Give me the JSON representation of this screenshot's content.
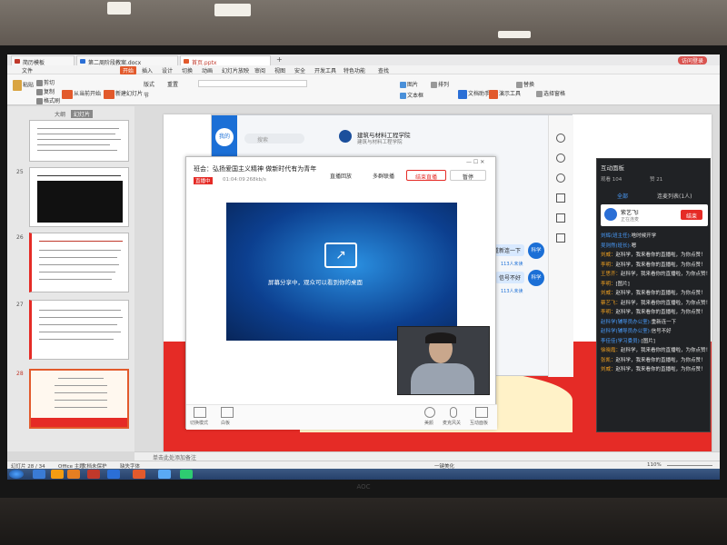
{
  "wps": {
    "tabs": [
      "简历模板",
      "第二周阶段教案.docx",
      "首页.pptx"
    ],
    "menu": [
      "文件",
      "开始",
      "插入",
      "设计",
      "切换",
      "动画",
      "幻灯片放映",
      "审阅",
      "视图",
      "安全",
      "开发工具",
      "特色功能",
      "查找"
    ],
    "menu_active": "开始",
    "login": "访问登录",
    "ribbon": {
      "paste": "粘贴",
      "cut": "剪切",
      "copy": "复制",
      "format": "格式刷",
      "from_current": "从当前开始",
      "new_slide": "新建幻灯片",
      "layout": "版式",
      "section": "节",
      "reset": "重置",
      "picture": "图片",
      "textbox": "文本框",
      "arrange": "排列",
      "doc_helper": "文档助手",
      "presentation_tools": "演示工具",
      "replace": "替换",
      "select_pane": "选择窗格"
    },
    "panel_tabs": [
      "大纲",
      "幻灯片"
    ],
    "slide_numbers": [
      "25",
      "26",
      "27",
      "28"
    ],
    "notes": "单击此处添加备注",
    "status_left": "幻灯片 28 / 34",
    "status_theme": "Office 主题",
    "status_doc": "文档未保护",
    "status_font": "缺失字体",
    "status_zoom": "110%",
    "status_beautify": "一键美化"
  },
  "qq": {
    "avatar_label": "我的",
    "search_placeholder": "搜索",
    "group_name": "建筑与材料工程学院",
    "group_sub": "建筑与材料工程学院",
    "msgs": [
      {
        "text": "重新连一下",
        "sender": "科学",
        "count": "113人未读"
      },
      {
        "text": "信号不好",
        "sender": "科学",
        "count": "113人未读"
      }
    ]
  },
  "live": {
    "title": "班会：弘扬爱国主义精神   做新时代有为青年",
    "badge": "直播中",
    "time": "01:04:09",
    "speed": "268kb/s",
    "btn_replay": "直播回放",
    "btn_multi": "多群联播",
    "btn_end": "结束直播",
    "btn_pause": "暂停",
    "sharing_text": "屏幕分享中，观众可以看到你的桌面",
    "bottom_left": [
      "切换模式",
      "白板"
    ],
    "bottom_right": [
      "美颜",
      "麦克风关",
      "互动面板"
    ]
  },
  "chat": {
    "title": "互动面板",
    "viewers_label": "观看",
    "viewers": "104",
    "likes_label": "赞",
    "likes": "21",
    "tabs": [
      "全部",
      "连麦列表(1人)"
    ],
    "card_name": "紫艺飞l",
    "card_sub": "正在连麦",
    "card_btn": "结束",
    "messages": [
      {
        "name": "刘辉(班主任):",
        "text": "啥时候开学",
        "c": "#4a9eff"
      },
      {
        "name": "吴则然(班长):",
        "text": "嗯",
        "c": "#4a9eff"
      },
      {
        "name": "刘威：",
        "text": "赵科学，我来看你的直播啦，为你点赞！",
        "c": "#f0a020"
      },
      {
        "name": "李明：",
        "text": "赵科学，我来看你的直播啦，为你点赞！",
        "c": "#f0a020"
      },
      {
        "name": "王思齐：",
        "text": "赵科学，我来看你的直播啦，为你点赞！",
        "c": "#f0a020"
      },
      {
        "name": "李明：",
        "text": "[图片]",
        "c": "#f0a020"
      },
      {
        "name": "刘威：",
        "text": "赵科学，我来看你的直播啦，为你点赞！",
        "c": "#f0a020"
      },
      {
        "name": "蔡艺飞：",
        "text": "赵科学，我来看你的直播啦，为你点赞！",
        "c": "#f0a020"
      },
      {
        "name": "李明：",
        "text": "赵科学，我来看你的直播啦，为你点赞！",
        "c": "#f0a020"
      },
      {
        "name": "赵科学(辅导员办公室):",
        "text": "重新连一下",
        "c": "#4a9eff"
      },
      {
        "name": "赵科学(辅导员办公室):",
        "text": "信号不好",
        "c": "#4a9eff"
      },
      {
        "name": "李佳佳(学习委员):",
        "text": "[图片]",
        "c": "#4a9eff"
      },
      {
        "name": "徐晓霞：",
        "text": "赵科学，我来看你的直播啦，为你点赞！",
        "c": "#f0a020"
      },
      {
        "name": "张凯：",
        "text": "赵科学，我来看你的直播啦，为你点赞！",
        "c": "#f0a020"
      },
      {
        "name": "刘威：",
        "text": "赵科学，我来看你的直播啦，为你点赞！",
        "c": "#f0a020"
      }
    ]
  },
  "monitor_brand": "AOC"
}
